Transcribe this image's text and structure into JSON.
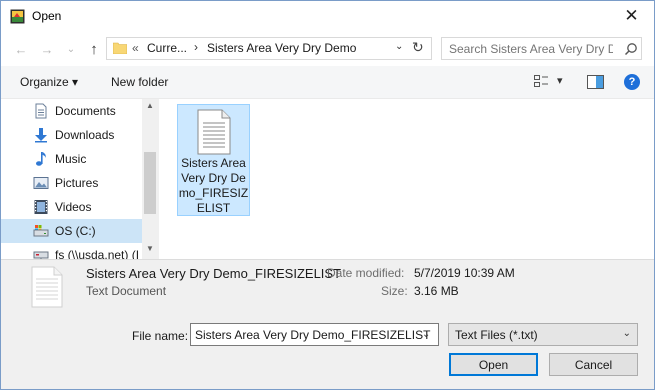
{
  "window": {
    "title": "Open",
    "close_glyph": "✕"
  },
  "navigation": {
    "back_glyph": "←",
    "forward_glyph": "→",
    "history_glyph": "⌄",
    "up_glyph": "↑",
    "breadcrumb_prefix": "«",
    "breadcrumbs": [
      "Curre...",
      "Sisters Area Very Dry Demo"
    ],
    "separator": "›",
    "dropdown_glyph": "⌄",
    "refresh_glyph": "↻"
  },
  "search": {
    "placeholder": "Search Sisters Area Very Dry D..."
  },
  "toolbar": {
    "organize_label": "Organize ▾",
    "new_folder_label": "New folder",
    "view_dropdown_glyph": "▾",
    "help_glyph": "?"
  },
  "sidebar": {
    "items": [
      {
        "label": "Documents",
        "icon": "documents-icon",
        "selected": false
      },
      {
        "label": "Downloads",
        "icon": "downloads-icon",
        "selected": false
      },
      {
        "label": "Music",
        "icon": "music-icon",
        "selected": false
      },
      {
        "label": "Pictures",
        "icon": "pictures-icon",
        "selected": false
      },
      {
        "label": "Videos",
        "icon": "videos-icon",
        "selected": false
      },
      {
        "label": "OS (C:)",
        "icon": "drive-icon",
        "selected": true
      },
      {
        "label": "fs (\\\\usda.net) (I",
        "icon": "network-drive-icon",
        "selected": false
      }
    ],
    "scroll_up_glyph": "▲",
    "scroll_down_glyph": "▼"
  },
  "files": [
    {
      "name": "Sisters Area Very Dry Demo_FIRESIZELIST",
      "icon": "text-document-icon",
      "selected": true
    }
  ],
  "details": {
    "name": "Sisters Area Very Dry Demo_FIRESIZELIST",
    "type": "Text Document",
    "date_modified_label": "Date modified:",
    "date_modified": "5/7/2019 10:39 AM",
    "size_label": "Size:",
    "size": "3.16 MB"
  },
  "footer": {
    "file_name_label": "File name:",
    "file_name_value": "Sisters Area Very Dry Demo_FIRESIZELIST",
    "file_name_dropdown_glyph": "⌄",
    "file_type_value": "Text Files (*.txt)",
    "file_type_dropdown_glyph": "⌄",
    "open_label": "Open",
    "cancel_label": "Cancel"
  },
  "colors": {
    "accent": "#0078d7",
    "selection": "#cce8ff",
    "selection_border": "#99d1ff",
    "sidebar_selected": "#cce4f7",
    "help_blue": "#1e6fd9"
  }
}
